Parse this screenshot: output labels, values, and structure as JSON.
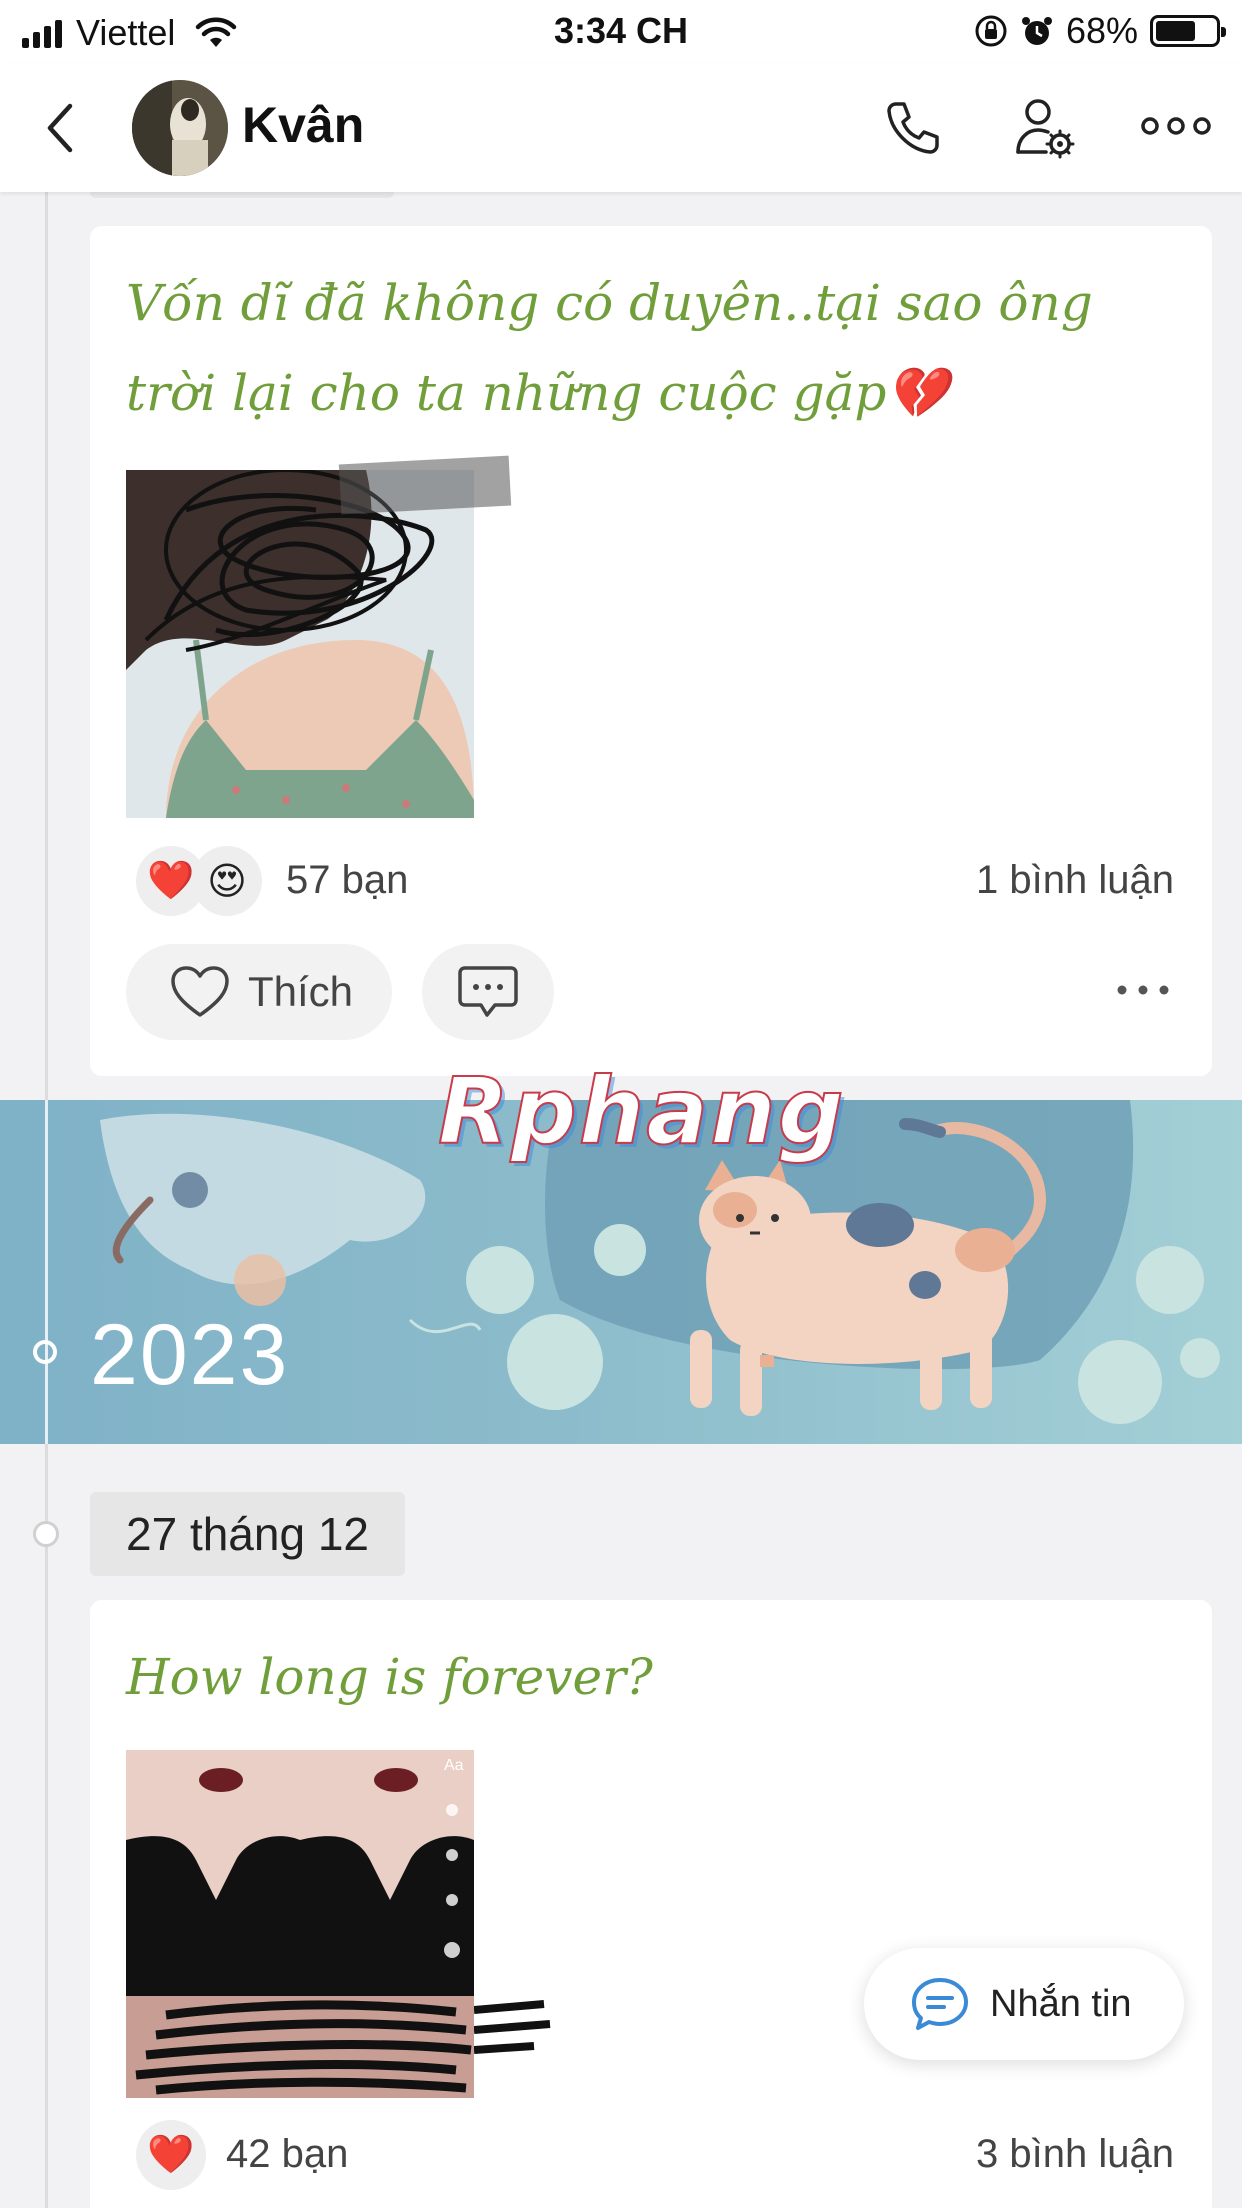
{
  "status_bar": {
    "carrier": "Viettel",
    "time": "3:34 CH",
    "battery": "68%",
    "battery_level": 0.68
  },
  "header": {
    "name": "Kvân",
    "back_icon": "chevron-left-icon",
    "call_icon": "phone-icon",
    "settings_icon": "user-settings-icon",
    "more_icon": "more-horizontal-icon"
  },
  "posts": [
    {
      "text": "Vốn dĩ đã không có duyên..tại sao ông trời lại cho ta những cuộc gặp💔",
      "reactions": [
        "❤️",
        "😍"
      ],
      "reaction_count": "57 bạn",
      "comment_count": "1 bình luận",
      "like_label": "Thích"
    },
    {
      "date": "27 tháng 12",
      "text": "How long is forever?",
      "reactions": [
        "❤️"
      ],
      "reaction_count": "42 bạn",
      "comment_count": "3 bình luận"
    }
  ],
  "year_banner": {
    "year": "2023"
  },
  "watermark": "Rphang",
  "message_button": {
    "label": "Nhắn tin",
    "icon": "chat-bubble-icon"
  },
  "colors": {
    "post_text": "#6f9e3a",
    "banner": "#8cbccb",
    "fab_icon": "#3a8ad6"
  }
}
